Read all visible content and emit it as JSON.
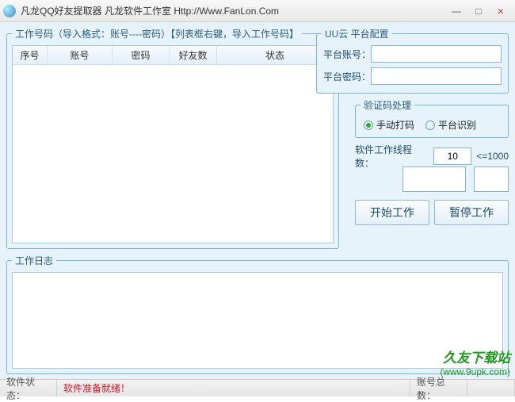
{
  "window": {
    "title": "凡龙QQ好友提取器 凡龙软件工作室 Http://Www.FanLon.Com"
  },
  "groups": {
    "accounts_title": "工作号码（导入格式：账号----密码）【列表框右键，导入工作号码】",
    "platform_title": "UU云 平台配置",
    "captcha_title": "验证码处理",
    "log_title": "工作日志"
  },
  "table": {
    "headers": [
      "序号",
      "账号",
      "密码",
      "好友数",
      "状态"
    ]
  },
  "platform": {
    "account_label": "平台账号：",
    "password_label": "平台密码：",
    "account_value": "",
    "password_value": ""
  },
  "captcha": {
    "manual_label": "手动打码",
    "auto_label": "平台识别",
    "selected": "manual"
  },
  "threads": {
    "label": "软件工作线程数：",
    "value": "10",
    "hint": "<=1000"
  },
  "buttons": {
    "start": "开始工作",
    "pause": "暂停工作"
  },
  "statusbar": {
    "status_label": "软件状态：",
    "status_value": "软件准备就绪！",
    "total_label": "账号总数：",
    "total_value": ""
  },
  "watermark": {
    "site_name": "久友下载站",
    "site_url": "(www.9upk.com)"
  }
}
